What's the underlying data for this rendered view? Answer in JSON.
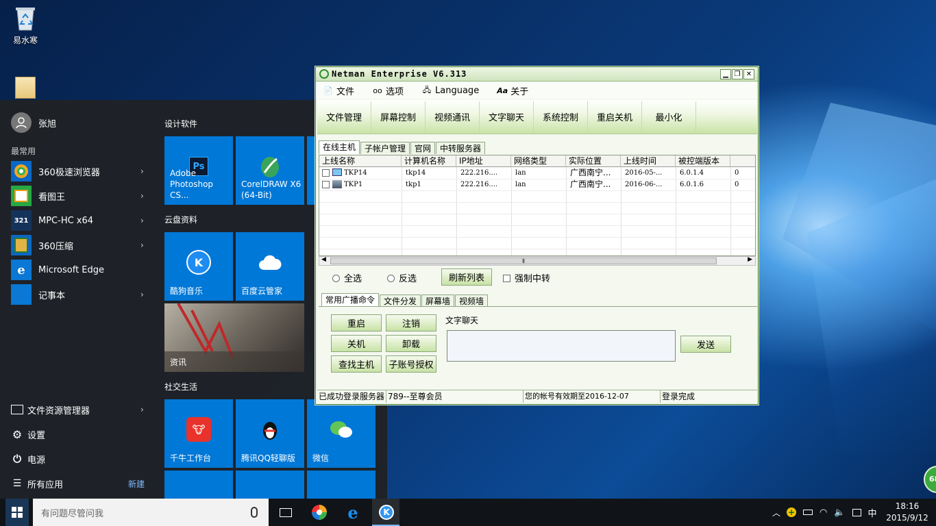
{
  "desktop": {
    "icons": [
      {
        "label": "易水寒",
        "name": "recycle-bin"
      }
    ]
  },
  "start_menu": {
    "user": "张旭",
    "most_used_header": "最常用",
    "apps": [
      {
        "label": "360极速浏览器",
        "icon": "360-browser-icon",
        "chevron": "›"
      },
      {
        "label": "看图王",
        "icon": "image-viewer-icon",
        "chevron": "›"
      },
      {
        "label": "MPC-HC x64",
        "icon": "mpc-hc-icon",
        "chevron": "›"
      },
      {
        "label": "360压缩",
        "icon": "360-zip-icon",
        "chevron": "›"
      },
      {
        "label": "Microsoft Edge",
        "icon": "edge-icon",
        "chevron": ""
      },
      {
        "label": "记事本",
        "icon": "notepad-icon",
        "chevron": "›"
      }
    ],
    "bottom": [
      {
        "label": "文件资源管理器",
        "icon": "file-explorer-icon",
        "chevron": "›"
      },
      {
        "label": "设置",
        "icon": "gear-icon",
        "chevron": ""
      },
      {
        "label": "电源",
        "icon": "power-icon",
        "chevron": ""
      },
      {
        "label": "所有应用",
        "icon": "all-apps-icon",
        "chevron": "",
        "extra": "新建"
      }
    ],
    "groups": {
      "design": "设计软件",
      "cloud": "云盘资料",
      "social": "社交生活"
    },
    "tiles": {
      "photoshop": {
        "line1": "Adobe",
        "line2": "Photoshop CS...",
        "icon_text": "Ps"
      },
      "coreldraw": {
        "line1": "CorelDRAW X6",
        "line2": "(64-Bit)"
      },
      "kugou": "酷狗音乐",
      "baidu": "百度云管家",
      "news": "资讯",
      "qianniu": "千牛工作台",
      "qq": "腾讯QQ轻聊版",
      "wechat": "微信"
    }
  },
  "taskbar": {
    "search_placeholder": "有问题尽管问我",
    "ime": "中",
    "time": "18:16",
    "date": "2015/9/12",
    "badge": "68"
  },
  "netman": {
    "title": "Netman Enterprise V6.313",
    "menu": [
      {
        "label": "文件",
        "icon": "file-icon"
      },
      {
        "label": "选项",
        "icon": "glasses-icon"
      },
      {
        "label": "Language",
        "icon": "language-icon"
      },
      {
        "label": "关于",
        "icon": "about-icon"
      }
    ],
    "toolbar": [
      "文件管理",
      "屏幕控制",
      "视频通讯",
      "文字聊天",
      "系统控制",
      "重启关机",
      "最小化"
    ],
    "tabs": [
      "在线主机",
      "子帐户管理",
      "官网",
      "中转服务器"
    ],
    "columns": [
      "上线名称",
      "计算机名称",
      "IP地址",
      "网络类型",
      "实际位置",
      "上线时间",
      "被控端版本",
      ""
    ],
    "rows": [
      [
        "TKP14",
        "tkp14",
        "222.216....",
        "lan",
        "广西南宁...",
        "2016-05-...",
        "6.0.1.4",
        "0"
      ],
      [
        "TKP1",
        "tkp1",
        "222.216....",
        "lan",
        "广西南宁...",
        "2016-06-...",
        "6.0.1.6",
        "0"
      ]
    ],
    "scroll_grip": "⦀",
    "select_all": "全选",
    "invert": "反选",
    "refresh": "刷新列表",
    "force_relay": "强制中转",
    "sub_tabs": [
      "常用广播命令",
      "文件分发",
      "屏幕墙",
      "视频墙"
    ],
    "cmd_buttons": [
      "重启",
      "注销",
      "关机",
      "卸载",
      "查找主机",
      "子账号授权"
    ],
    "chat_label": "文字聊天",
    "send": "发送",
    "status": [
      "已成功登录服务器",
      "789--至尊会员",
      "您的帐号有效期至2016-12-07",
      "登录完成"
    ]
  }
}
